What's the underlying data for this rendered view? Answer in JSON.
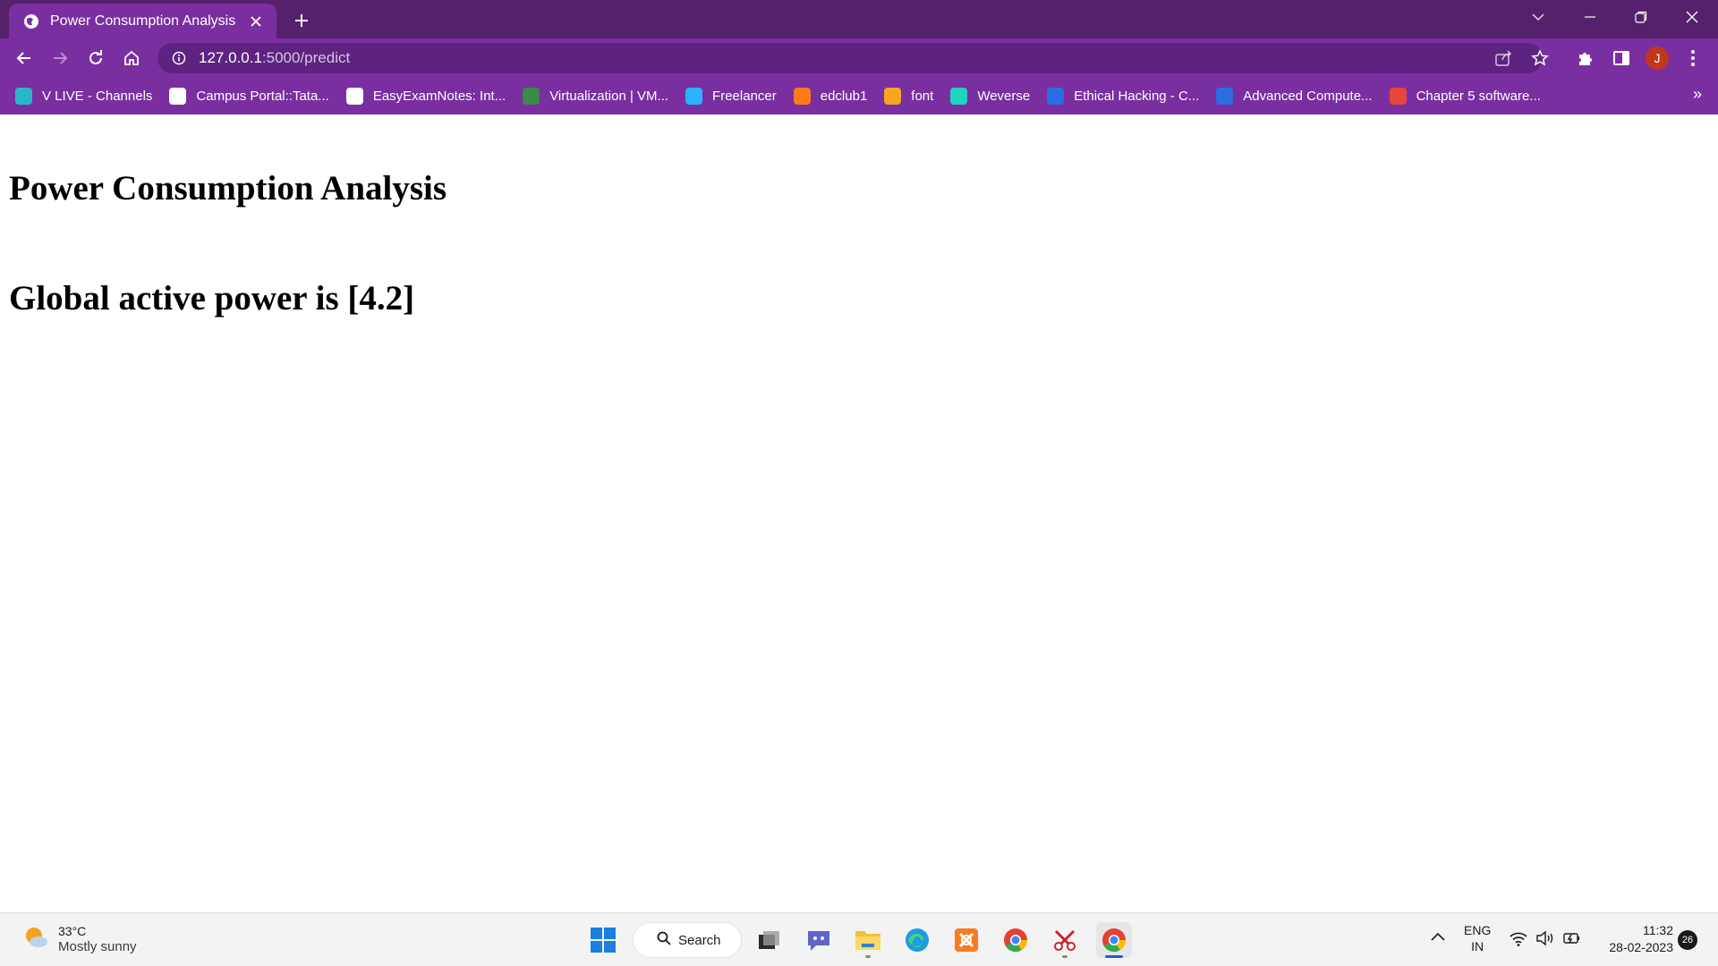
{
  "browser": {
    "tab": {
      "title": "Power Consumption Analysis",
      "favicon": "globe-icon"
    },
    "url": {
      "host": "127.0.0.1",
      "path": ":5000/predict"
    },
    "profile_initial": "J",
    "bookmarks": [
      {
        "label": "V LIVE - Channels",
        "icon": "vlive-icon",
        "color": "#2bb5c9"
      },
      {
        "label": "Campus Portal::Tata...",
        "icon": "tcs-icon",
        "color": "#ffffff"
      },
      {
        "label": "EasyExamNotes: Int...",
        "icon": "globe-icon",
        "color": "#ffffff"
      },
      {
        "label": "Virtualization | VM...",
        "icon": "vm-icon",
        "color": "#3a8a4a"
      },
      {
        "label": "Freelancer",
        "icon": "freelancer-icon",
        "color": "#29b2fe"
      },
      {
        "label": "edclub1",
        "icon": "edclub-icon",
        "color": "#ff7a1a"
      },
      {
        "label": "font",
        "icon": "font-icon",
        "color": "#f5a623"
      },
      {
        "label": "Weverse",
        "icon": "weverse-icon",
        "color": "#1fd5c1"
      },
      {
        "label": "Ethical Hacking - C...",
        "icon": "site-icon",
        "color": "#2c6ee0"
      },
      {
        "label": "Advanced Compute...",
        "icon": "site-icon",
        "color": "#2c6ee0"
      },
      {
        "label": "Chapter 5 software...",
        "icon": "slides-icon",
        "color": "#e8453c"
      }
    ],
    "more_bookmarks": "»"
  },
  "page": {
    "heading": "Power Consumption Analysis",
    "result": "Global active power is [4.2]"
  },
  "taskbar": {
    "weather": {
      "temp": "33°C",
      "desc": "Mostly sunny"
    },
    "search_label": "Search",
    "language": {
      "line1": "ENG",
      "line2": "IN"
    },
    "time": "11:32",
    "date": "28-02-2023",
    "notification_count": "26"
  }
}
